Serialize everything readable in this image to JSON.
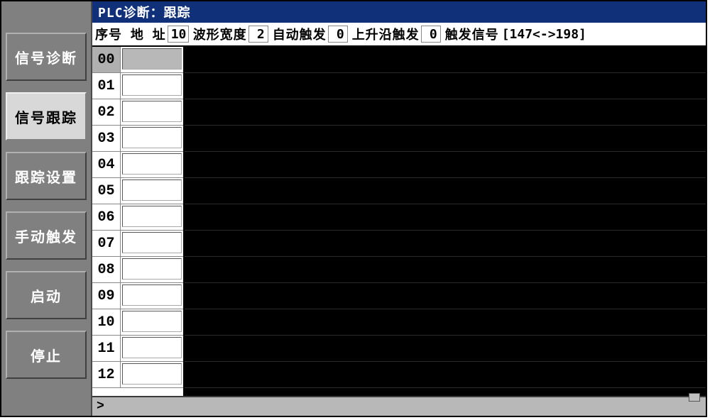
{
  "titlebar": {
    "text": "PLC诊断：跟踪"
  },
  "sidebar": {
    "items": [
      {
        "label": "信号诊断",
        "active": false
      },
      {
        "label": "信号跟踪",
        "active": true
      },
      {
        "label": "跟踪设置",
        "active": false
      },
      {
        "label": "手动触发",
        "active": false
      },
      {
        "label": "启动",
        "active": false
      },
      {
        "label": "停止",
        "active": false
      }
    ]
  },
  "params": {
    "seq_addr_label": "序号 地   址",
    "seq_addr_value": "10",
    "wave_width_label": "波形宽度",
    "wave_width_value": "2",
    "auto_trigger_label": "自动触发",
    "auto_trigger_value": "0",
    "rising_edge_label": "上升沿触发",
    "rising_edge_value": "0",
    "trigger_signal_label": "触发信号",
    "trigger_signal_value": "[147<->198]"
  },
  "addr_rows": [
    {
      "num": "00",
      "val": "",
      "selected": true,
      "disabled": true
    },
    {
      "num": "01",
      "val": "",
      "selected": false,
      "disabled": false
    },
    {
      "num": "02",
      "val": "",
      "selected": false,
      "disabled": false
    },
    {
      "num": "03",
      "val": "",
      "selected": false,
      "disabled": false
    },
    {
      "num": "04",
      "val": "",
      "selected": false,
      "disabled": false
    },
    {
      "num": "05",
      "val": "",
      "selected": false,
      "disabled": false
    },
    {
      "num": "06",
      "val": "",
      "selected": false,
      "disabled": false
    },
    {
      "num": "07",
      "val": "",
      "selected": false,
      "disabled": false
    },
    {
      "num": "08",
      "val": "",
      "selected": false,
      "disabled": false
    },
    {
      "num": "09",
      "val": "",
      "selected": false,
      "disabled": false
    },
    {
      "num": "10",
      "val": "",
      "selected": false,
      "disabled": false
    },
    {
      "num": "11",
      "val": "",
      "selected": false,
      "disabled": false
    },
    {
      "num": "12",
      "val": "",
      "selected": false,
      "disabled": false
    }
  ],
  "footer": {
    "prompt": ">"
  }
}
